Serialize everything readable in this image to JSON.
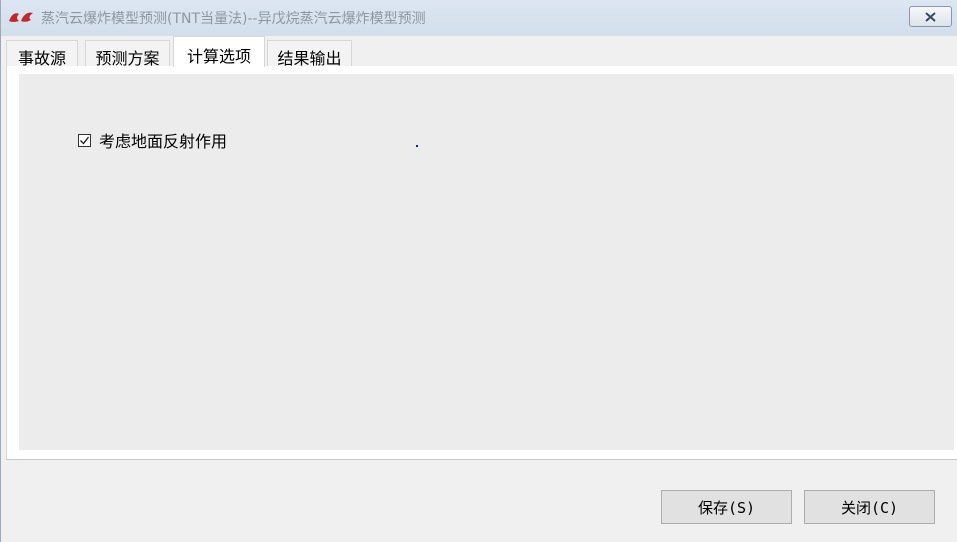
{
  "window": {
    "title": "蒸汽云爆炸模型预测(TNT当量法)--异戊烷蒸汽云爆炸模型预测",
    "close_icon": "close-icon"
  },
  "tabs": [
    {
      "label": "事故源",
      "active": false
    },
    {
      "label": "预测方案",
      "active": false
    },
    {
      "label": "计算选项",
      "active": true
    },
    {
      "label": "结果输出",
      "active": false
    }
  ],
  "options": {
    "ground_reflection": {
      "label": "考虑地面反射作用",
      "checked": true
    }
  },
  "footer": {
    "save_label": "保存(S)",
    "close_label": "关闭(C)"
  },
  "colors": {
    "title_text": "#8e96a4",
    "titlebar": "#d3deec",
    "panel": "#ececec",
    "app_icon": "#c0282d"
  }
}
